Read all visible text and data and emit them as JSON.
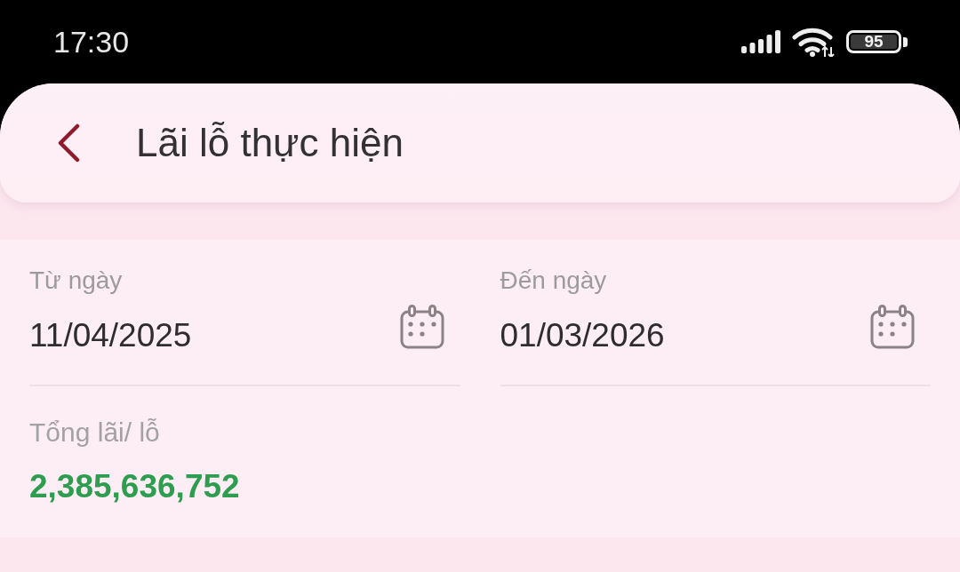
{
  "status_bar": {
    "time": "17:30",
    "battery": "95"
  },
  "header": {
    "title": "Lãi lỗ thực hiện"
  },
  "filters": [
    {
      "label": "Từ ngày",
      "value": "11/04/2025"
    },
    {
      "label": "Đến ngày",
      "value": "01/03/2026"
    }
  ],
  "summary": {
    "label": "Tổng lãi/ lỗ",
    "value": "2,385,636,752",
    "positive": true
  }
}
